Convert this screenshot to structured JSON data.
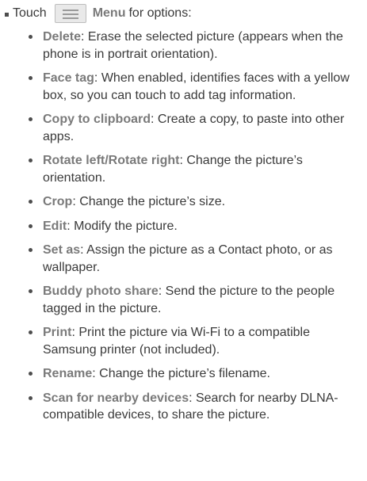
{
  "intro": {
    "prefix": "Touch",
    "menu_icon": "menu-icon",
    "menu_label": "Menu",
    "suffix": "for options:"
  },
  "items": [
    {
      "term": "Delete",
      "desc": ": Erase the selected picture (appears when the phone is in portrait orientation)."
    },
    {
      "term": "Face tag",
      "desc": ": When enabled, identifies faces with a yellow box, so you can touch to add tag information."
    },
    {
      "term": "Copy to clipboard",
      "desc": ": Create a copy, to paste into other apps."
    },
    {
      "term": "Rotate left/Rotate right",
      "desc": ": Change the picture’s orientation."
    },
    {
      "term": "Crop",
      "desc": ": Change the picture’s size."
    },
    {
      "term": "Edit",
      "desc": ": Modify the picture."
    },
    {
      "term": "Set as",
      "desc": ": Assign the picture as a Contact photo, or as wallpaper."
    },
    {
      "term": "Buddy photo share",
      "desc": ": Send the picture to the people tagged in the picture."
    },
    {
      "term": "Print",
      "desc": ": Print the picture via Wi-Fi to a compatible Samsung printer (not included)."
    },
    {
      "term": "Rename",
      "desc": ": Change the picture’s filename."
    },
    {
      "term": "Scan for nearby devices",
      "desc": ": Search for nearby DLNA-compatible devices, to share the picture."
    }
  ],
  "colors": {
    "text": "#3a3a3a",
    "term": "#7a7a7a",
    "bullet": "#4d4d4d"
  }
}
